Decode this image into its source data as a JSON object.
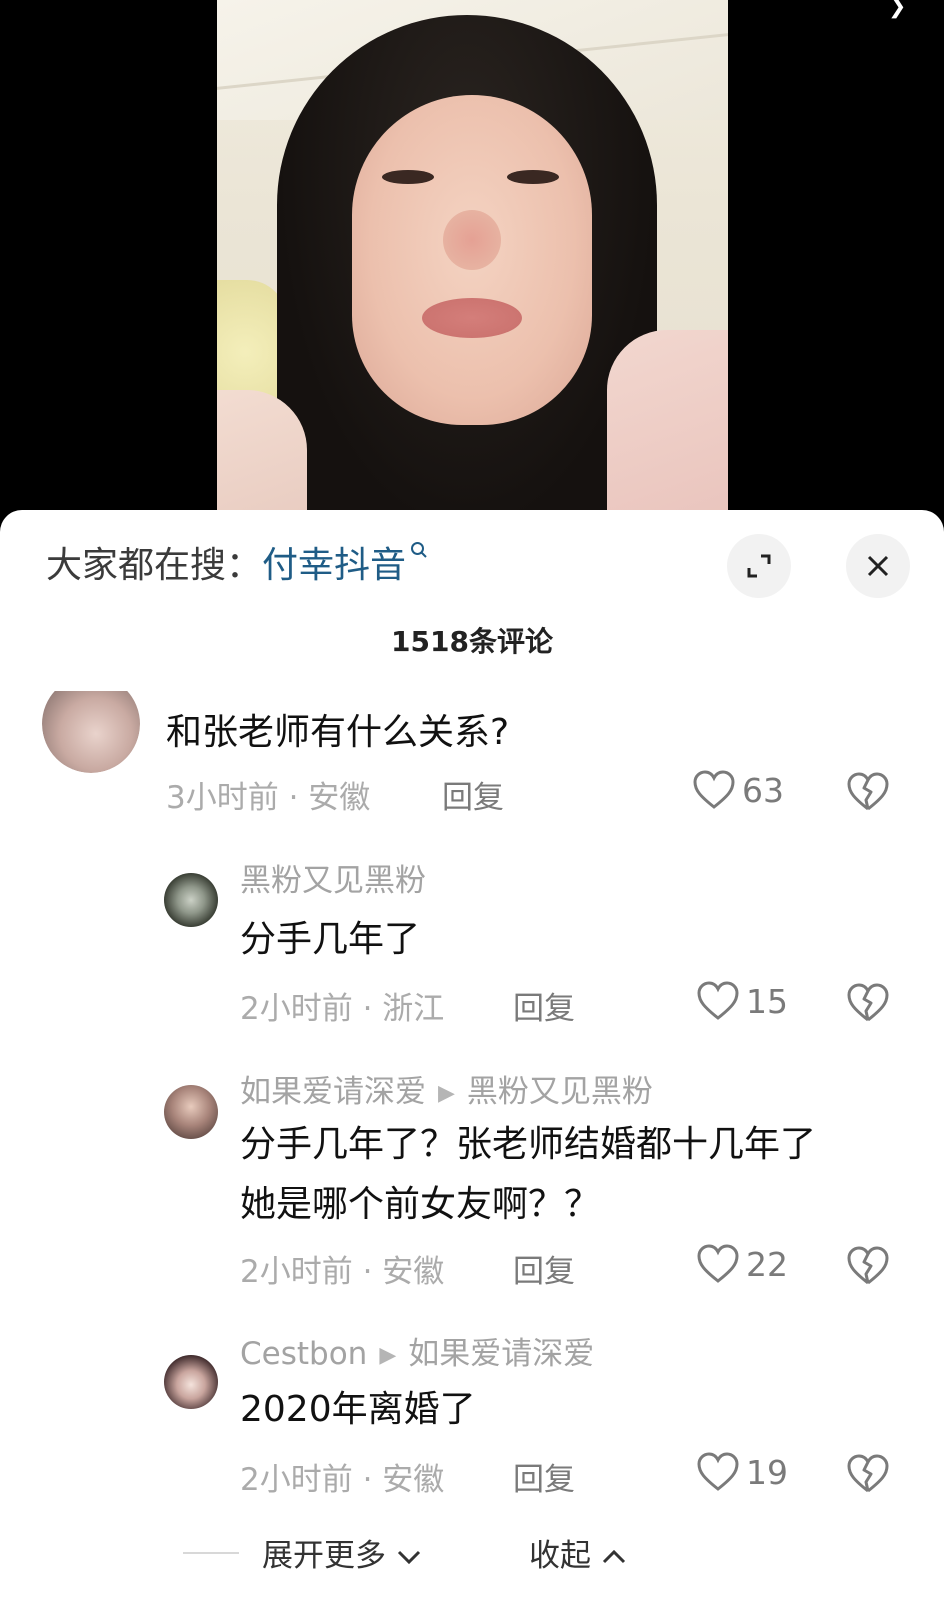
{
  "search": {
    "label": "大家都在搜：",
    "term": "付幸抖音"
  },
  "comments_count": "1518条评论",
  "comments": [
    {
      "text": "和张老师有什么关系?",
      "time": "3小时前 · 安徽",
      "reply": "回复",
      "likes": "63"
    },
    {
      "name": "黑粉又见黑粉",
      "text": "分手几年了",
      "time": "2小时前 · 浙江",
      "reply": "回复",
      "likes": "15"
    },
    {
      "name": "如果爱请深爱",
      "reply_to": "黑粉又见黑粉",
      "text_line1": "分手几年了？张老师结婚都十几年了",
      "text_line2": "她是哪个前女友啊？？",
      "time": "2小时前 · 安徽",
      "reply": "回复",
      "likes": "22"
    },
    {
      "name": "Cestbon",
      "reply_to": "如果爱请深爱",
      "text": "2020年离婚了",
      "time": "2小时前 · 安徽",
      "reply": "回复",
      "likes": "19"
    }
  ],
  "footer": {
    "expand": "展开更多",
    "collapse": "收起"
  },
  "colors": {
    "search_term": "#1f5c86",
    "panel_bg": "#ffffff",
    "meta": "#ababab"
  },
  "icons": [
    "search-icon",
    "expand-icon",
    "close-icon",
    "heart-icon",
    "broken-heart-icon",
    "chevron-down-icon",
    "chevron-up-icon",
    "arrow-right-icon"
  ]
}
